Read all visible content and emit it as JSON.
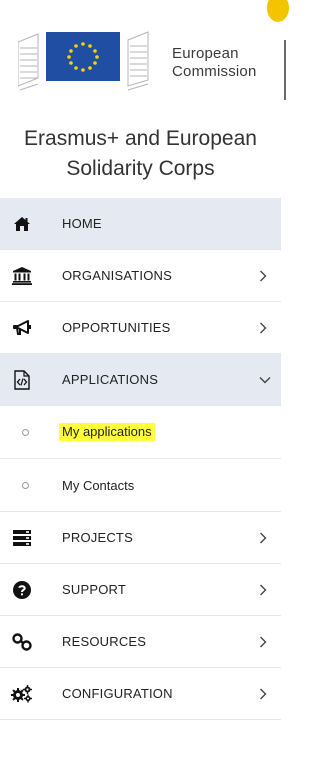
{
  "header": {
    "org_line1": "European",
    "org_line2": "Commission",
    "app_title_line1": "Erasmus+ and European",
    "app_title_line2": "Solidarity Corps",
    "flag_color": "#1f4ea3",
    "star_color": "#ffd200",
    "accent_color": "#f5c400"
  },
  "menu": [
    {
      "label": "HOME",
      "icon": "home-icon",
      "has_chevron": false,
      "active": true
    },
    {
      "label": "ORGANISATIONS",
      "icon": "bank-icon",
      "has_chevron": true,
      "active": false
    },
    {
      "label": "OPPORTUNITIES",
      "icon": "megaphone-icon",
      "has_chevron": true,
      "active": false
    },
    {
      "label": "APPLICATIONS",
      "icon": "code-file-icon",
      "has_chevron": true,
      "expanded": true,
      "active": true
    }
  ],
  "submenu": [
    {
      "label": "My applications",
      "highlighted": true
    },
    {
      "label": "My Contacts",
      "highlighted": false
    }
  ],
  "menu2": [
    {
      "label": "PROJECTS",
      "icon": "server-icon",
      "has_chevron": true
    },
    {
      "label": "SUPPORT",
      "icon": "question-circle-icon",
      "has_chevron": true
    },
    {
      "label": "RESOURCES",
      "icon": "link-icon",
      "has_chevron": true
    },
    {
      "label": "CONFIGURATION",
      "icon": "cogs-icon",
      "has_chevron": true
    }
  ],
  "colors": {
    "active_bg": "#e4e9f2",
    "highlight": "#ffff3c",
    "divider": "#e6e6e6"
  }
}
